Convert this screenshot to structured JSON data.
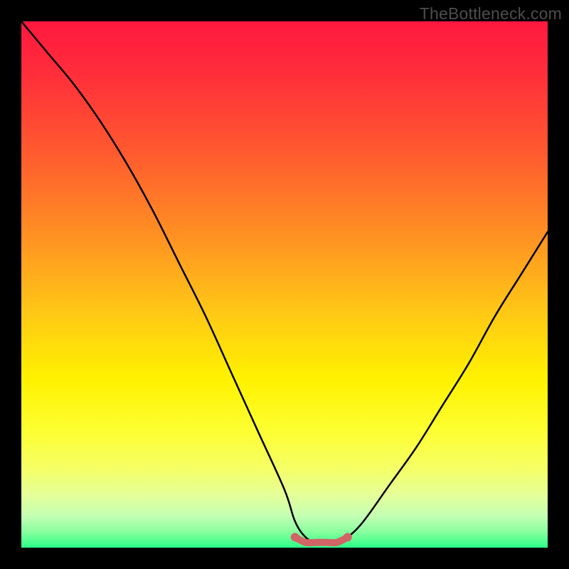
{
  "watermark": "TheBottleneck.com",
  "chart_data": {
    "type": "line",
    "title": "",
    "xlabel": "",
    "ylabel": "",
    "xlim": [
      0,
      100
    ],
    "ylim": [
      0,
      100
    ],
    "series": [
      {
        "name": "bottleneck-curve",
        "x": [
          0,
          5,
          10,
          15,
          20,
          25,
          30,
          35,
          40,
          45,
          50,
          52,
          54,
          56,
          58,
          60,
          62,
          65,
          70,
          75,
          80,
          85,
          90,
          95,
          100
        ],
        "y": [
          100,
          94,
          88,
          81,
          73,
          64,
          54,
          44,
          33,
          22,
          11,
          5,
          2,
          1,
          1,
          1,
          2,
          5,
          12,
          19,
          27,
          35,
          44,
          52,
          60
        ]
      },
      {
        "name": "flat-segment",
        "x": [
          52,
          54,
          56,
          58,
          60,
          62
        ],
        "y": [
          2,
          1,
          1,
          1,
          1,
          2
        ]
      }
    ],
    "flat_segment_color": "#d16464",
    "curve_color": "#000000",
    "gradient_stops": [
      {
        "pos": 0,
        "color": "#ff183f"
      },
      {
        "pos": 55,
        "color": "#ffc716"
      },
      {
        "pos": 78,
        "color": "#fdff33"
      },
      {
        "pos": 100,
        "color": "#2bff88"
      }
    ]
  }
}
